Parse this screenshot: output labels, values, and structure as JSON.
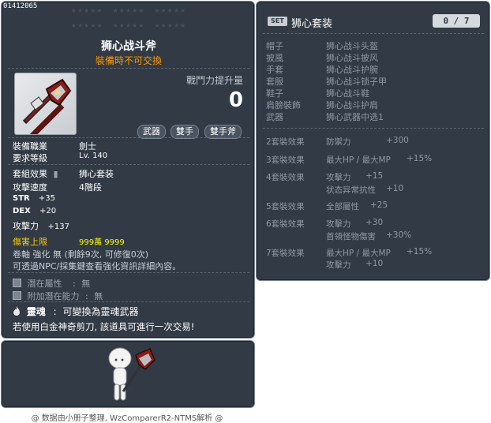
{
  "item": {
    "id": "01412065",
    "name": "狮心战斗斧",
    "trade_note": "裝備時不可交換",
    "power_label": "戰鬥力提升量",
    "power_value": "0",
    "tags": [
      "武器",
      "雙手",
      "雙手斧"
    ],
    "job_label": "裝備職業",
    "job_value": "劍士",
    "level_label": "要求等級",
    "level_value": "Lv. 140",
    "set_label": "套組效果",
    "set_value": "狮心套装",
    "speed_label": "攻擊速度",
    "speed_value": "4階段",
    "str_label": "STR",
    "str_value": "+35",
    "dex_label": "DEX",
    "dex_value": "+20",
    "atk_label": "攻擊力",
    "atk_value": "+137",
    "dmgcap_label": "傷害上限",
    "dmgcap_value": "999萬 9999",
    "scroll_text": "卷軸 強化 無 (剩餘9次, 可修復0次)",
    "scroll_hint": "可透過NPC/採集鍵查看強化資訊詳細內容。",
    "potential_label": "潛在屬性",
    "potential_value": "無",
    "bonus_potential_label": "附加潛在能力",
    "bonus_potential_value": "無",
    "soul_label": "靈魂",
    "soul_value": "可變換為靈魂武器",
    "platinum_note": "若使用白金神奇剪刀, 該道具可進行一次交易!"
  },
  "set": {
    "badge": "SET",
    "name": "狮心套装",
    "count": "0 / 7",
    "pieces": [
      {
        "slot": "帽子",
        "name": "狮心战斗头盔"
      },
      {
        "slot": "披風",
        "name": "狮心战斗披风"
      },
      {
        "slot": "手套",
        "name": "狮心战斗护腕"
      },
      {
        "slot": "套服",
        "name": "狮心战斗锁子甲"
      },
      {
        "slot": "鞋子",
        "name": "狮心战斗鞋"
      },
      {
        "slot": "肩膀裝飾",
        "name": "狮心战斗护肩"
      },
      {
        "slot": "武器",
        "name": "狮心武器中选1"
      }
    ],
    "bonuses": [
      {
        "head": "2套裝效果",
        "lines": [
          {
            "stat": "防禦力",
            "val": "+300"
          }
        ]
      },
      {
        "head": "3套裝效果",
        "lines": [
          {
            "stat": "最大HP / 最大MP",
            "val": "+15%"
          }
        ]
      },
      {
        "head": "4套裝效果",
        "lines": [
          {
            "stat": "攻擊力",
            "val": "+15"
          },
          {
            "stat": "状态异常抗性",
            "val": "+10"
          }
        ]
      },
      {
        "head": "5套裝效果",
        "lines": [
          {
            "stat": "全部屬性",
            "val": "+25"
          }
        ]
      },
      {
        "head": "6套裝效果",
        "lines": [
          {
            "stat": "攻擊力",
            "val": "+30"
          },
          {
            "stat": "首領怪物傷害",
            "val": "+30%"
          }
        ]
      },
      {
        "head": "7套裝效果",
        "lines": [
          {
            "stat": "最大HP / 最大MP",
            "val": "+15%"
          },
          {
            "stat": "攻擊力",
            "val": "+10"
          }
        ]
      }
    ]
  },
  "footer": "@ 数据由小册子整理, WzComparerR2-NTMS解析 @",
  "colors": {
    "panel_bg": "#313a45",
    "trade_orange": "#ff9900",
    "dmgcap_yellow": "#ffff00",
    "set_text": "#8f98a3"
  }
}
